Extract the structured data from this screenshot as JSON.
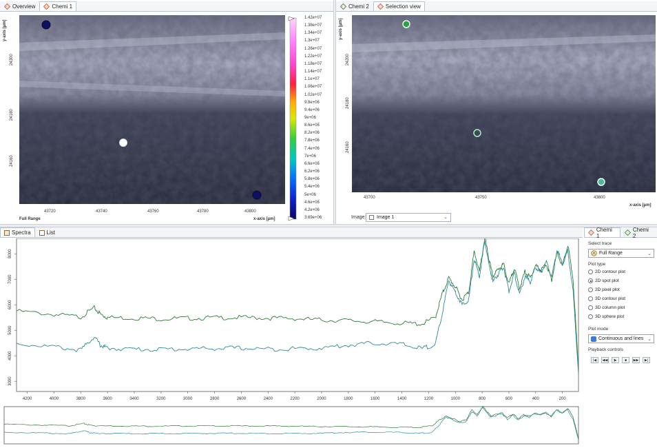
{
  "left_view": {
    "tabs": [
      {
        "label": "Overview",
        "icon": "diamond-icon"
      },
      {
        "label": "Chemi 1",
        "icon": "diamond-icon"
      }
    ],
    "y_axis_title": "y-axis [µm]",
    "y_ticks": [
      "24300",
      "24180",
      "24160"
    ],
    "x_ticks": [
      "43720",
      "43740",
      "43760",
      "43780",
      "43800"
    ],
    "x_axis_title": "x-axis [µm]",
    "corner_label": "Full Range",
    "colorbar_labels": [
      "1.42e+07",
      "1.38e+07",
      "1.34e+07",
      "1.3e+07",
      "1.26e+07",
      "1.22e+07",
      "1.18e+07",
      "1.14e+07",
      "1.1e+07",
      "1.06e+07",
      "1.02e+07",
      "9.8e+06",
      "9.4e+06",
      "9e+06",
      "8.6e+06",
      "8.2e+06",
      "7.8e+06",
      "7.4e+06",
      "7e+06",
      "6.6e+06",
      "6.2e+06",
      "5.8e+06",
      "5.4e+06",
      "5e+06",
      "4.6e+06",
      "4.2e+06",
      "3.69e+06"
    ]
  },
  "right_view": {
    "tabs": [
      {
        "label": "Chemi 2",
        "icon": "diamond-icon"
      },
      {
        "label": "Selection view",
        "icon": "diamond-icon"
      }
    ],
    "y_axis_title": "y-axis [µm]",
    "y_ticks": [
      "24200",
      "24180",
      "24160"
    ],
    "x_ticks": [
      "43700",
      "43750",
      "43800"
    ],
    "x_axis_title": "x-axis [µm]",
    "image_label": "Image:",
    "image_value": "Image 1"
  },
  "spectra": {
    "tabs": [
      {
        "label": "Spectra",
        "icon": "spectra-icon"
      },
      {
        "label": "List",
        "icon": "list-icon"
      }
    ],
    "colors": {
      "series1": "#2e7d32",
      "series2": "#2d8a9a"
    }
  },
  "chart_data": {
    "type": "line",
    "title": "",
    "xlabel": "",
    "ylabel": "",
    "x_ticks": [
      "4200",
      "4000",
      "3800",
      "3600",
      "3400",
      "3200",
      "3000",
      "2800",
      "2600",
      "2400",
      "2200",
      "2000",
      "1800",
      "1600",
      "1400",
      "1200",
      "1000",
      "800",
      "600",
      "400",
      "200"
    ],
    "y_ticks": [
      "3000",
      "4000",
      "5000",
      "6000",
      "7000",
      "8000"
    ],
    "xlim": [
      4280,
      80
    ],
    "ylim": [
      2600,
      8600
    ],
    "x": [
      4280,
      4000,
      3800,
      3700,
      3650,
      3600,
      3400,
      3200,
      3000,
      2800,
      2600,
      2400,
      2200,
      2000,
      1800,
      1600,
      1400,
      1250,
      1150,
      1100,
      1050,
      1000,
      950,
      900,
      860,
      820,
      780,
      750,
      720,
      680,
      640,
      600,
      560,
      520,
      480,
      440,
      400,
      360,
      320,
      280,
      240,
      200,
      160,
      120,
      80
    ],
    "series": [
      {
        "values": [
          5750,
          5620,
          5520,
          5880,
          5620,
          5500,
          5480,
          5450,
          5470,
          5490,
          5500,
          5480,
          5460,
          5400,
          5380,
          5330,
          5280,
          5250,
          5500,
          6400,
          7050,
          6700,
          6200,
          6500,
          8100,
          7300,
          8650,
          7800,
          7100,
          7400,
          7600,
          6800,
          7450,
          6650,
          7300,
          7050,
          7550,
          7350,
          7600,
          6950,
          8050,
          7500,
          8350,
          7000,
          3400
        ]
      },
      {
        "values": [
          4480,
          4350,
          4220,
          4750,
          4400,
          4300,
          4260,
          4250,
          4270,
          4290,
          4300,
          4260,
          4280,
          4300,
          4420,
          4500,
          4450,
          4280,
          4450,
          5600,
          6950,
          6500,
          6000,
          6200,
          7800,
          7100,
          8500,
          7600,
          6900,
          7200,
          7500,
          6500,
          7250,
          6400,
          7100,
          6900,
          7450,
          7250,
          7700,
          7100,
          8150,
          7600,
          8100,
          6500,
          3300
        ]
      }
    ],
    "legend": "none",
    "grid": false
  },
  "side_panel": {
    "tabs": [
      {
        "label": "Chemi 1",
        "icon": "diamond-icon"
      },
      {
        "label": "Chemi 2",
        "icon": "diamond-icon"
      }
    ],
    "select_trace_label": "Select trace",
    "select_trace_value": "Full Range",
    "plot_type_label": "Plot type",
    "plot_types": [
      {
        "label": "2D contour plot",
        "selected": false
      },
      {
        "label": "2D spot plot",
        "selected": true
      },
      {
        "label": "2D pixel plot",
        "selected": false
      },
      {
        "label": "3D contour plot",
        "selected": false
      },
      {
        "label": "3D column plot",
        "selected": false
      },
      {
        "label": "3D sphere plot",
        "selected": false
      }
    ],
    "plot_mode_label": "Plot mode",
    "plot_mode_value": "Continuous and lines",
    "playback_label": "Playback controls",
    "playback_buttons": [
      "|◀",
      "◀◀",
      "▶",
      "■",
      "▶▶",
      "▶|"
    ]
  }
}
